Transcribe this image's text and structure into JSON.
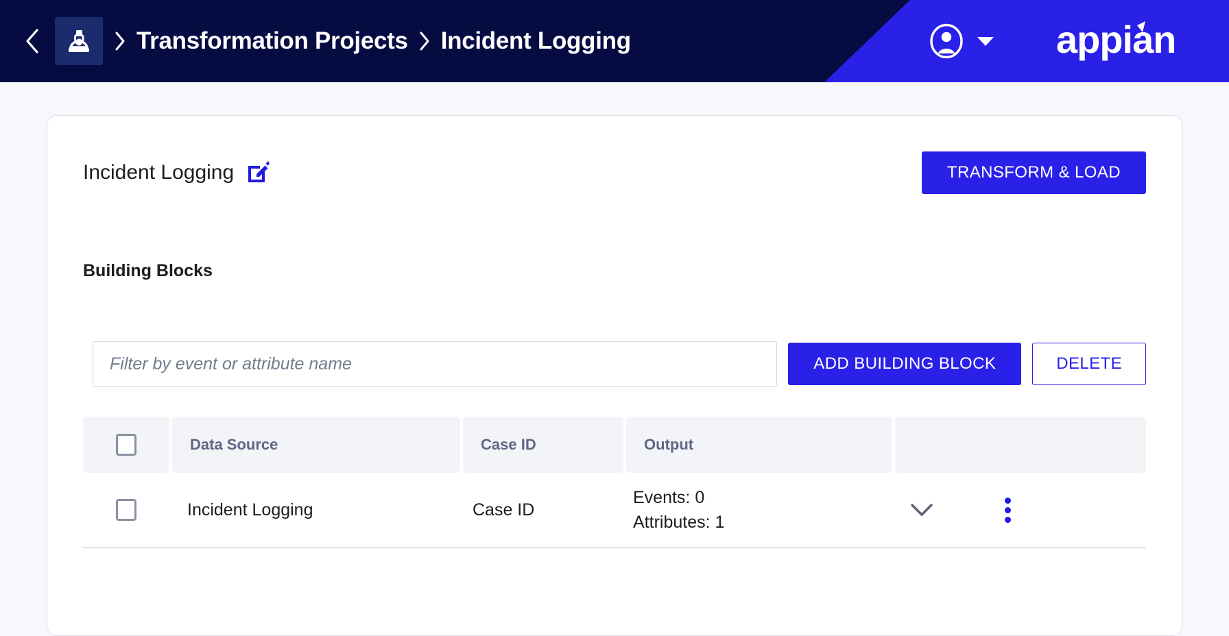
{
  "topbar": {
    "back_label": "Back",
    "back_icon": "chevron-left-icon",
    "app_icon": "microscope-icon",
    "breadcrumbs": [
      {
        "label": "Transformation Projects",
        "separator": "›"
      },
      {
        "label": "Incident Logging",
        "separator": "›"
      }
    ],
    "user_icon": "user-circle-icon",
    "user_caret_icon": "caret-down-icon",
    "brand": "appian",
    "colors": {
      "bar_background": "#060b42",
      "accent_diagonal": "#2a21e8",
      "app_tile": "#1c2a6e"
    }
  },
  "card": {
    "title": "Incident Logging",
    "edit_icon": "edit-pencil-square-icon",
    "primary_action": "TRANSFORM & LOAD",
    "section_title": "Building Blocks"
  },
  "toolbar": {
    "filter_placeholder": "Filter by event or attribute name",
    "filter_value": "",
    "add_label": "ADD BUILDING BLOCK",
    "delete_label": "DELETE"
  },
  "table": {
    "columns": [
      "",
      "Data Source",
      "Case ID",
      "Output",
      ""
    ],
    "select_all_checked": false,
    "rows": [
      {
        "selected": false,
        "data_source": "Incident Logging",
        "case_id": "Case ID",
        "output_events": "Events: 0",
        "output_attributes": "Attributes: 1",
        "expand_icon": "chevron-down-icon",
        "menu_icon": "kebab-menu-icon"
      }
    ]
  },
  "colors": {
    "accent": "#2a21e8",
    "page_background": "#f7f8fb",
    "header_cell": "#f3f4f7",
    "header_text": "#5f6785"
  }
}
